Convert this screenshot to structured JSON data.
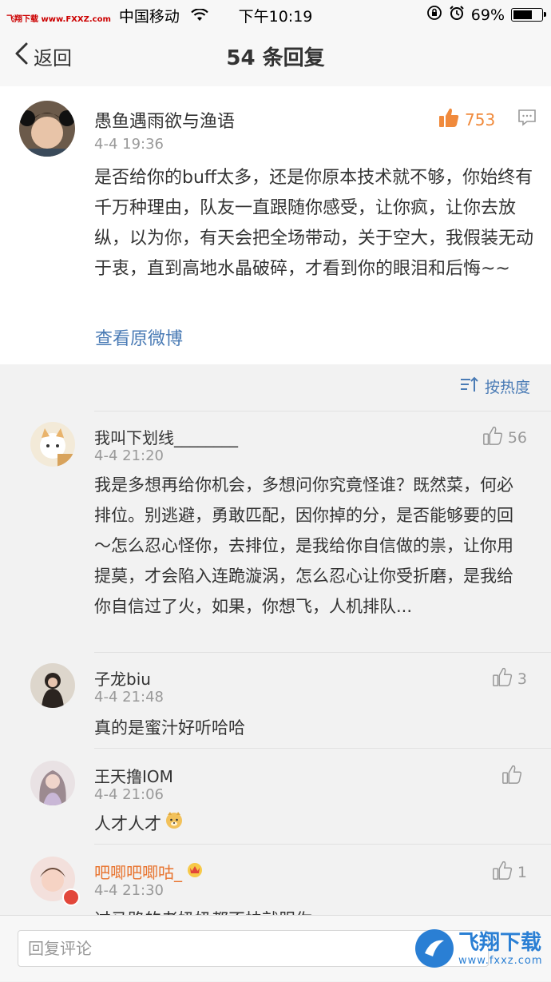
{
  "statusbar": {
    "watermark": "飞翔下载 www.FXXZ.com",
    "carrier": "中国移动",
    "time": "下午10:19",
    "battery": "69%",
    "battery_level": 0.69
  },
  "nav": {
    "back_label": "返回",
    "title": "54 条回复"
  },
  "main_comment": {
    "name": "愚鱼遇雨欲与渔语",
    "time": "4-4 19:36",
    "likes": "753",
    "text": "是否给你的buff太多，还是你原本技术就不够，你始终有千万种理由，队友一直跟随你感受，让你疯，让你去放纵，以为你，有天会把全场带动，关于空大，我假装无动于衷，直到高地水晶破碎，才看到你的眼泪和后悔~~",
    "view_original": "查看原微博"
  },
  "sort": {
    "label": "按热度"
  },
  "replies": [
    {
      "name": "我叫下划线________",
      "time": "4-4 21:20",
      "likes": "56",
      "text": "我是多想再给你机会，多想问你究竟怪谁？既然菜，何必排位。别逃避，勇敢匹配，因你掉的分，是否能够要的回～怎么忍心怪你，去排位，是我给你自信做的祟，让你用提莫，才会陷入连跪漩涡，怎么忍心让你受折磨，是我给你自信过了火，如果，你想飞，人机排队..."
    },
    {
      "name": "子龙biu",
      "time": "4-4 21:48",
      "likes": "3",
      "text": "真的是蜜汁好听哈哈"
    },
    {
      "name": "王天撸IOM",
      "time": "4-4 21:06",
      "likes": "",
      "text": "人才人才"
    },
    {
      "name": "吧唧吧唧咕_",
      "time": "4-4 21:30",
      "likes": "1",
      "text": "过马路的老奶奶都不扶就服你"
    }
  ],
  "input": {
    "placeholder": "回复评论"
  },
  "watermark_bottom": {
    "line1": "飞翔下载",
    "line2": "www.fxxz.com"
  },
  "colors": {
    "link": "#4a7bb5",
    "like_orange": "#f08a3c",
    "vip_name": "#e8722c"
  }
}
